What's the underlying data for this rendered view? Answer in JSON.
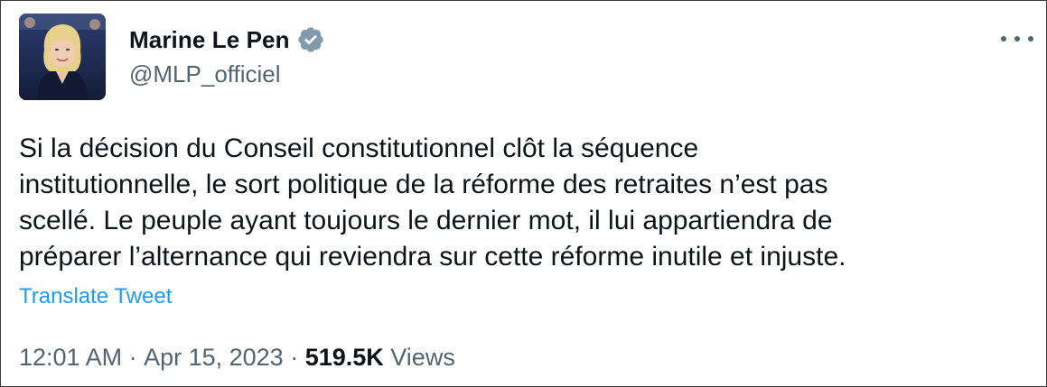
{
  "author": {
    "display_name": "Marine Le Pen",
    "handle": "@MLP_officiel",
    "verified": true
  },
  "tweet": {
    "text": "Si la décision du Conseil constitutionnel clôt la séquence\ninstitutionnelle, le sort politique de la réforme des retraites n’est pas\nscellé. Le peuple ayant toujours le dernier mot, il lui appartiendra de\npréparer l’alternance qui reviendra sur cette réforme inutile et injuste.",
    "translate_label": "Translate Tweet"
  },
  "meta": {
    "time": "12:01 AM",
    "separator": " · ",
    "date": "Apr 15, 2023",
    "views_count": "519.5K",
    "views_label": " Views"
  },
  "icons": {
    "verified": "verified-badge-icon",
    "more": "more-horizontal-icon"
  },
  "colors": {
    "text_primary": "#0f1419",
    "text_secondary": "#536471",
    "link": "#1d9bf0",
    "verified_badge": "#829aab"
  }
}
